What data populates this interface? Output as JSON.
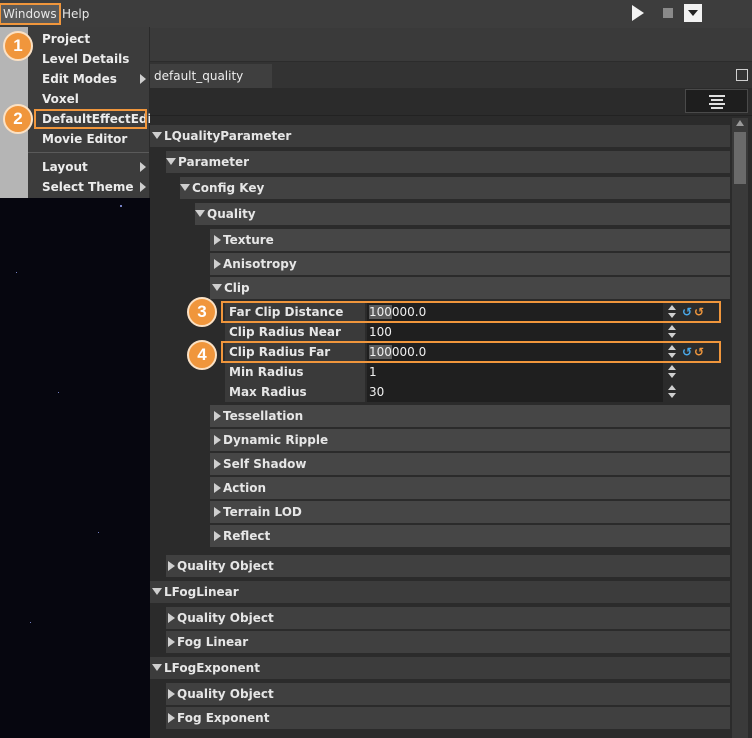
{
  "menubar": {
    "windows_label": "Windows",
    "help_label": "Help"
  },
  "dropdown": {
    "items": [
      {
        "label": "Project"
      },
      {
        "label": "Level Details"
      },
      {
        "label": "Edit Modes"
      },
      {
        "label": "Voxel"
      },
      {
        "label": "DefaultEffectEdit"
      },
      {
        "label": "Movie Editor"
      },
      {
        "label": "Layout"
      },
      {
        "label": "Select Theme"
      }
    ]
  },
  "badges": [
    "1",
    "2",
    "3",
    "4"
  ],
  "panel": {
    "tab_label": "default_quality"
  },
  "tree": {
    "lquality": "LQualityParameter",
    "parameter": "Parameter",
    "config_key": "Config Key",
    "quality": "Quality",
    "texture": "Texture",
    "anisotropy": "Anisotropy",
    "clip": "Clip",
    "props": [
      {
        "label": "Far Clip Distance",
        "value_hl": "100",
        "value_rest": "000.0"
      },
      {
        "label": "Clip Radius Near",
        "value_hl": "",
        "value_rest": "100"
      },
      {
        "label": "Clip Radius Far",
        "value_hl": "100",
        "value_rest": "000.0"
      },
      {
        "label": "Min Radius",
        "value_hl": "",
        "value_rest": "1"
      },
      {
        "label": "Max Radius",
        "value_hl": "",
        "value_rest": "30"
      }
    ],
    "tessellation": "Tessellation",
    "dynamic_ripple": "Dynamic Ripple",
    "self_shadow": "Self Shadow",
    "action": "Action",
    "terrain_lod": "Terrain LOD",
    "reflect": "Reflect",
    "quality_object_1": "Quality Object",
    "lfoglinear": "LFogLinear",
    "quality_object_2": "Quality Object",
    "fog_linear": "Fog Linear",
    "lfogexponent": "LFogExponent",
    "quality_object_3": "Quality Object",
    "fog_exponent": "Fog Exponent"
  },
  "colors": {
    "accent": "#f0963c",
    "undo_blue": "#4aa8e8",
    "undo_orange": "#f0963c"
  }
}
